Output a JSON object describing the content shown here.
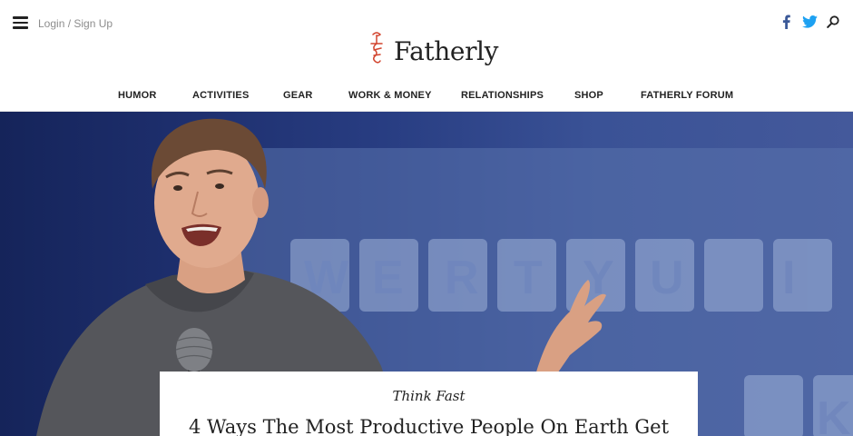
{
  "header": {
    "login_label": "Login / Sign Up",
    "brand_name": "Fatherly",
    "brand_color": "#d2452f",
    "social": [
      {
        "icon": "facebook-icon",
        "color": "#3b5998"
      },
      {
        "icon": "twitter-icon",
        "color": "#1da1f2"
      },
      {
        "icon": "search-icon",
        "color": "#222222"
      }
    ]
  },
  "nav": {
    "items": [
      {
        "label": "HUMOR"
      },
      {
        "label": "ACTIVITIES"
      },
      {
        "label": "GEAR"
      },
      {
        "label": "WORK & MONEY"
      },
      {
        "label": "RELATIONSHIPS"
      },
      {
        "label": "SHOP"
      },
      {
        "label": "FATHERLY FORUM"
      }
    ]
  },
  "hero": {
    "screen_letters": [
      "W",
      "E",
      "R",
      "T",
      "Y",
      "U",
      "I",
      "K"
    ]
  },
  "feature": {
    "kicker": "Think Fast",
    "headline": "4 Ways The Most Productive People On Earth Get"
  }
}
